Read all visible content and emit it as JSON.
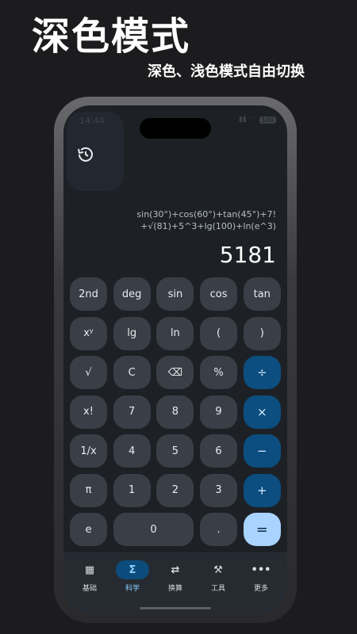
{
  "promo": {
    "title": "深色模式",
    "subtitle": "深色、浅色模式自由切换"
  },
  "status": {
    "time": "14:44",
    "battery": "100"
  },
  "display": {
    "expression_line1": "sin(30°)+cos(60°)+tan(45°)+7!",
    "expression_line2": "+√(81)+5^3+lg(100)+ln(e^3)",
    "result": "5181"
  },
  "keypad": {
    "row1": [
      "2nd",
      "deg",
      "sin",
      "cos",
      "tan"
    ],
    "row2": [
      "xʸ",
      "lg",
      "ln",
      "(",
      ")"
    ],
    "row3": [
      "√",
      "C",
      "⌫",
      "%",
      "÷"
    ],
    "row4": [
      "x!",
      "7",
      "8",
      "9",
      "×"
    ],
    "row5": [
      "1/x",
      "4",
      "5",
      "6",
      "−"
    ],
    "row6": [
      "π",
      "1",
      "2",
      "3",
      "+"
    ],
    "row7": [
      "e",
      "0",
      ".",
      "="
    ]
  },
  "nav": {
    "basic": {
      "label": "基础",
      "icon": "calculator-icon"
    },
    "science": {
      "label": "科学",
      "icon": "sigma-icon"
    },
    "convert": {
      "label": "换算",
      "icon": "swap-arrows-icon"
    },
    "tools": {
      "label": "工具",
      "icon": "tools-icon"
    },
    "more": {
      "label": "更多",
      "icon": "more-dots-icon"
    }
  },
  "colors": {
    "accent": "#0b4e7f",
    "equals": "#a9d4ff",
    "background": "#1d2126"
  }
}
